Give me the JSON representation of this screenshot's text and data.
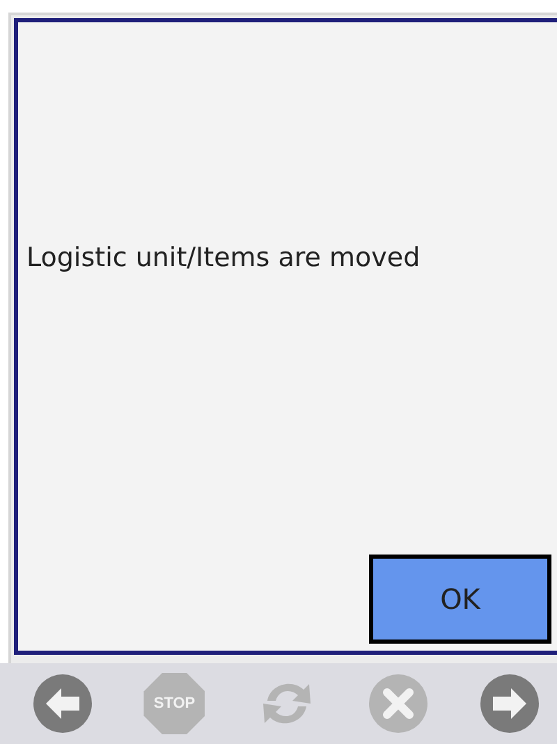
{
  "dialog": {
    "message": "Logistic unit/Items are moved",
    "ok_button": "OK"
  },
  "toolbar": [
    {
      "kind": "back",
      "disabled": false
    },
    {
      "kind": "stop",
      "label": "STOP",
      "disabled": true
    },
    {
      "kind": "refresh",
      "disabled": true
    },
    {
      "kind": "cancel",
      "disabled": true
    },
    {
      "kind": "forward",
      "disabled": false
    }
  ]
}
